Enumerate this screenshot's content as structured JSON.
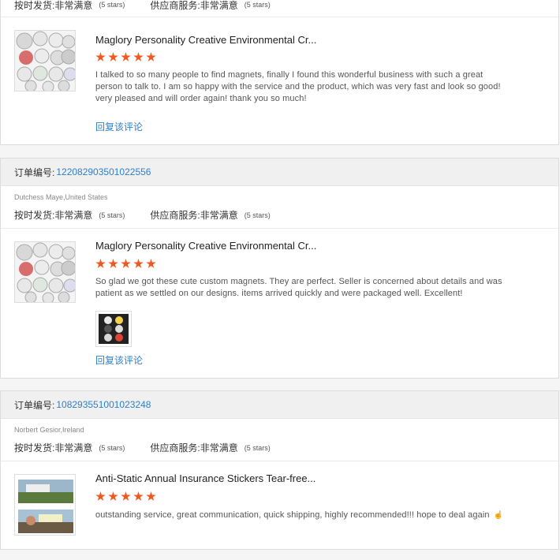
{
  "labels": {
    "order_no": "订单编号:",
    "ontime": "按时发货:",
    "supplier": "供应商服务:",
    "very_satisfied": "非常满意",
    "stars": "(5 stars)",
    "reply": "回复该评论"
  },
  "reviews": [
    {
      "product_title": "Maglory Personality Creative Environmental Cr...",
      "rating": 5,
      "review_text": "I talked to so many people to find magnets, finally I found this wonderful business with such a great person to talk to. I am so happy with the service and the product, which was very fast and look so good! very pleased and will order again! thank you so much!"
    },
    {
      "order_number": "122082903501022556",
      "buyer": "Dutchess Maye,United States",
      "product_title": "Maglory Personality Creative Environmental Cr...",
      "rating": 5,
      "review_text": "So glad we got these cute custom magnets. They are perfect. Seller is concerned about details and was patient as we settled on our designs. items arrived quickly and were packaged well. Excellent!"
    },
    {
      "order_number": "108293551001023248",
      "buyer": "Norbert Gesior,Ireland",
      "product_title": "Anti-Static Annual Insurance Stickers Tear-free...",
      "rating": 5,
      "review_text": "outstanding service, great communication, quick shipping, highly recommended!!! hope to deal again"
    }
  ],
  "colors": {
    "accent": "#f2581e",
    "link": "#2f7fc8"
  }
}
